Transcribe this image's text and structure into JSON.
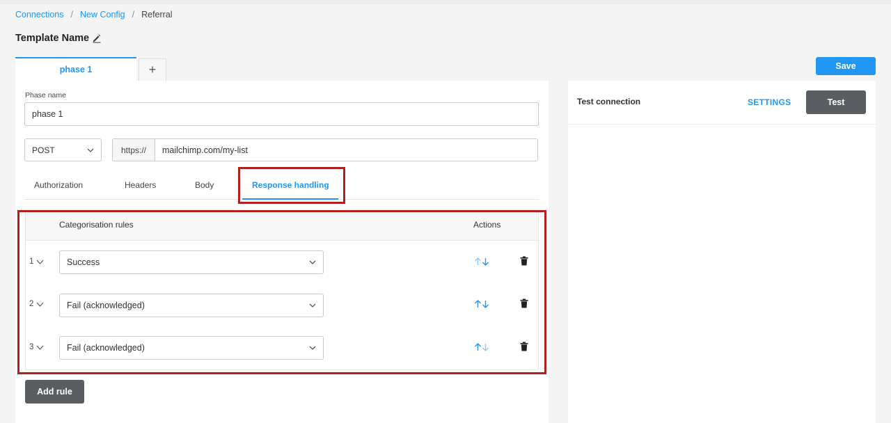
{
  "breadcrumb": {
    "items": [
      "Connections",
      "New Config",
      "Referral"
    ],
    "separator": "/"
  },
  "page": {
    "title": "Template Name"
  },
  "phase_tabs": {
    "active_label": "phase 1",
    "add_label": "+"
  },
  "toolbar": {
    "save_label": "Save"
  },
  "form": {
    "phase_name_label": "Phase name",
    "phase_name_value": "phase 1",
    "method": "POST",
    "url_prefix": "https://",
    "url_value": "mailchimp.com/my-list"
  },
  "subtabs": [
    "Authorization",
    "Headers",
    "Body",
    "Response handling"
  ],
  "active_subtab": "Response handling",
  "rules": {
    "header_rules": "Categorisation rules",
    "header_actions": "Actions",
    "rows": [
      {
        "index": "1",
        "value": "Success"
      },
      {
        "index": "2",
        "value": "Fail (acknowledged)"
      },
      {
        "index": "3",
        "value": "Fail (acknowledged)"
      }
    ],
    "add_label": "Add rule"
  },
  "test_panel": {
    "title": "Test connection",
    "settings_label": "SETTINGS",
    "test_label": "Test"
  },
  "colors": {
    "accent": "#2196f3",
    "highlight": "#b21f1f",
    "dark_button": "#5a5e63"
  },
  "icons": {
    "edit": "pencil-icon",
    "dropdown": "chevron-down-icon",
    "move": "arrow-up-down-icon",
    "delete": "trash-icon"
  }
}
